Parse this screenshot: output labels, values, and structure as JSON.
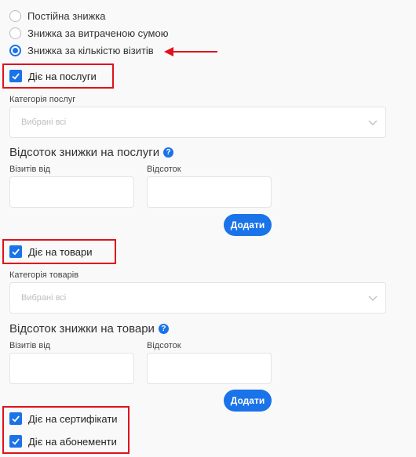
{
  "discount_types": [
    {
      "label": "Постійна знижка",
      "checked": false
    },
    {
      "label": "Знижка за витраченою сумою",
      "checked": false
    },
    {
      "label": "Знижка за кількістю візитів",
      "checked": true
    }
  ],
  "services": {
    "toggle_label": "Діє на послуги",
    "checked": true,
    "category_label": "Категорія послуг",
    "category_value": "Вибрані всі",
    "percent_title": "Відсоток знижки на послуги",
    "visits_from_label": "Візитів від",
    "percent_label": "Відсоток",
    "add_button": "Додати"
  },
  "products": {
    "toggle_label": "Діє на товари",
    "checked": true,
    "category_label": "Категорія товарів",
    "category_value": "Вибрані всі",
    "percent_title": "Відсоток знижки на товари",
    "visits_from_label": "Візитів від",
    "percent_label": "Відсоток",
    "add_button": "Додати"
  },
  "certificates": {
    "label": "Діє на сертифікати",
    "checked": true
  },
  "subscriptions": {
    "label": "Діє на абонементи",
    "checked": true
  },
  "help_glyph": "?",
  "colors": {
    "accent": "#1a73e8",
    "highlight": "#e0121b"
  }
}
